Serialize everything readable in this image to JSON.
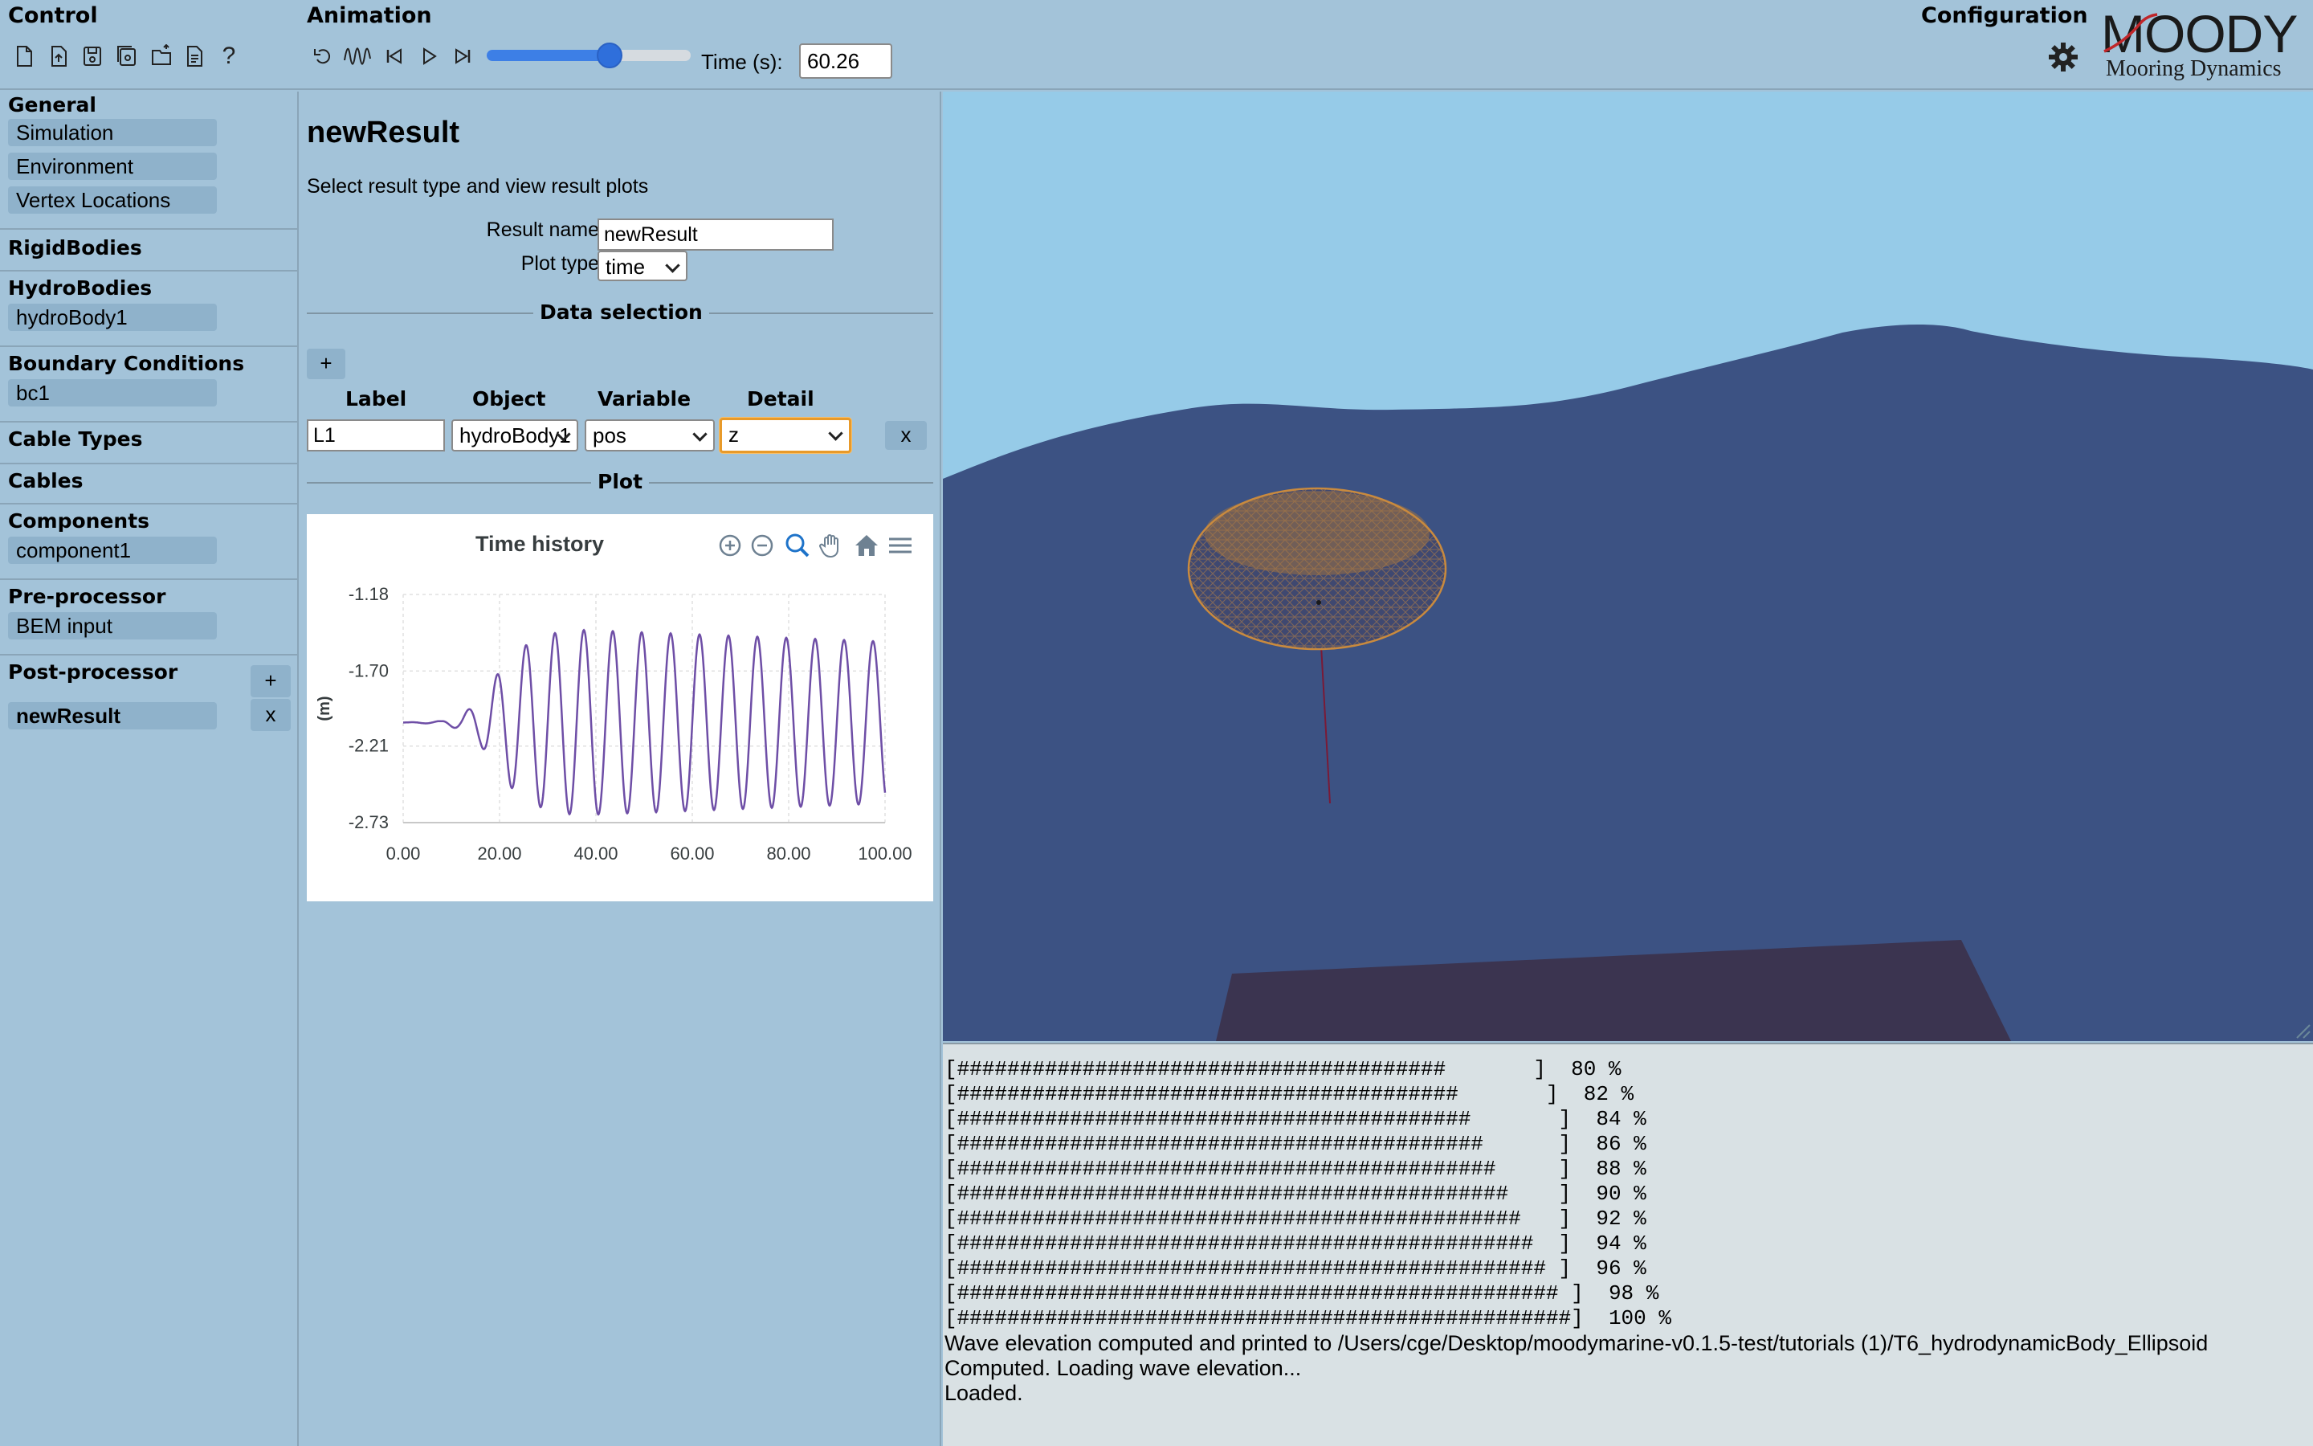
{
  "control": {
    "title": "Control",
    "icons": [
      "new-file-icon",
      "open-file-icon",
      "save-icon",
      "save-as-icon",
      "folder-export-icon",
      "document-icon",
      "help-icon"
    ],
    "help_label": "?"
  },
  "animation": {
    "title": "Animation",
    "icons": [
      "reset-icon",
      "wave-icon",
      "skip-back-icon",
      "play-icon",
      "skip-forward-icon"
    ],
    "progress": 0.6026,
    "time_label": "Time (s):",
    "time_value": "60.26"
  },
  "configuration": {
    "title": "Configuration",
    "logo_text": "MOODY",
    "logo_subtitle": "Mooring Dynamics"
  },
  "sidebar": {
    "general": {
      "title": "General",
      "items": [
        "Simulation",
        "Environment",
        "Vertex Locations"
      ]
    },
    "rigid_bodies": {
      "title": "RigidBodies"
    },
    "hydro_bodies": {
      "title": "HydroBodies",
      "items": [
        "hydroBody1"
      ]
    },
    "boundary_conditions": {
      "title": "Boundary Conditions",
      "items": [
        "bc1"
      ]
    },
    "cable_types": {
      "title": "Cable Types"
    },
    "cables": {
      "title": "Cables"
    },
    "components": {
      "title": "Components",
      "items": [
        "component1"
      ]
    },
    "pre_processor": {
      "title": "Pre-processor",
      "items": [
        "BEM input"
      ]
    },
    "post_processor": {
      "title": "Post-processor",
      "add_label": "+",
      "remove_label": "x",
      "items": [
        "newResult"
      ]
    }
  },
  "result": {
    "title": "newResult",
    "description": "Select result type and view result plots",
    "name_label": "Result name",
    "name_value": "newResult",
    "plot_type_label": "Plot type",
    "plot_type_value": "time",
    "data_selection_title": "Data selection",
    "add_label": "+",
    "columns": [
      "Label",
      "Object",
      "Variable",
      "Detail"
    ],
    "row": {
      "label": "L1",
      "object": "hydroBody1",
      "variable": "pos",
      "detail": "z",
      "remove_label": "x"
    },
    "plot_title": "Plot"
  },
  "chart_data": {
    "type": "line",
    "title": "Time history",
    "xlabel": "",
    "ylabel": "(m)",
    "xlim": [
      0,
      100
    ],
    "ylim": [
      -2.73,
      -1.18
    ],
    "xticks": [
      "0.00",
      "20.00",
      "40.00",
      "60.00",
      "80.00",
      "100.00"
    ],
    "yticks": [
      "-1.18",
      "-1.70",
      "-2.21",
      "-2.73"
    ],
    "grid": true,
    "series": [
      {
        "name": "L1",
        "color": "#6e4ea6",
        "mean": -2.05,
        "amplitude_envelope": [
          [
            0,
            0.0
          ],
          [
            8,
            0.01
          ],
          [
            12,
            0.05
          ],
          [
            16,
            0.15
          ],
          [
            20,
            0.35
          ],
          [
            24,
            0.5
          ],
          [
            30,
            0.6
          ],
          [
            36,
            0.63
          ],
          [
            100,
            0.55
          ]
        ],
        "period": 6.0
      }
    ],
    "tools": [
      "zoom-in-icon",
      "zoom-out-icon",
      "magnifier-icon",
      "pan-hand-icon",
      "home-icon",
      "menu-icon"
    ]
  },
  "console": {
    "progress_lines": [
      {
        "bar": "[#######################################       ]",
        "pct": "80 %"
      },
      {
        "bar": "[########################################       ]",
        "pct": "82 %"
      },
      {
        "bar": "[#########################################       ]",
        "pct": "84 %"
      },
      {
        "bar": "[##########################################      ]",
        "pct": "86 %"
      },
      {
        "bar": "[###########################################     ]",
        "pct": "88 %"
      },
      {
        "bar": "[############################################    ]",
        "pct": "90 %"
      },
      {
        "bar": "[#############################################   ]",
        "pct": "92 %"
      },
      {
        "bar": "[##############################################  ]",
        "pct": "94 %"
      },
      {
        "bar": "[############################################### ]",
        "pct": "96 %"
      },
      {
        "bar": "[################################################ ]",
        "pct": "98 %"
      },
      {
        "bar": "[#################################################]",
        "pct": "100 %"
      }
    ],
    "messages": [
      "Wave elevation computed and printed to /Users/cge/Desktop/moodymarine-v0.1.5-test/tutorials (1)/T6_hydrodynamicBody_Ellipsoid",
      "Computed. Loading wave elevation...",
      "Loaded."
    ]
  },
  "colors": {
    "panel_bg": "#a3c3d9",
    "item_bg": "#8fb2cb",
    "sky": "#96cbe8",
    "sea": "#3c5283",
    "seabed": "#3b3450",
    "body_mesh": "#c98a3e",
    "mooring_line": "#7a1a36",
    "accent": "#3d7fe6"
  }
}
